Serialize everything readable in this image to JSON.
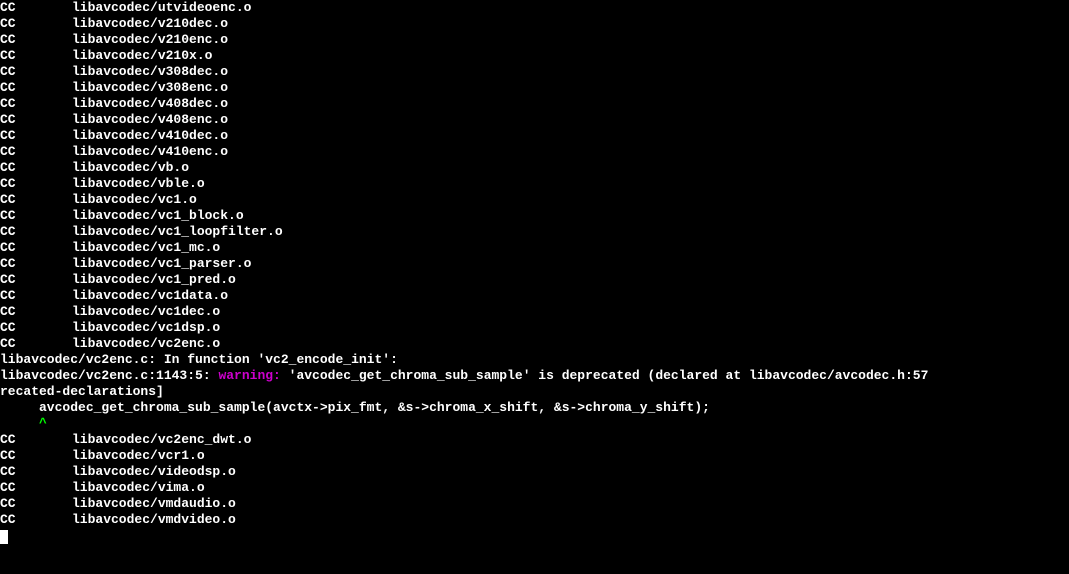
{
  "cc_lines_before": [
    {
      "label": "CC",
      "file": "libavcodec/utvideoenc.o"
    },
    {
      "label": "CC",
      "file": "libavcodec/v210dec.o"
    },
    {
      "label": "CC",
      "file": "libavcodec/v210enc.o"
    },
    {
      "label": "CC",
      "file": "libavcodec/v210x.o"
    },
    {
      "label": "CC",
      "file": "libavcodec/v308dec.o"
    },
    {
      "label": "CC",
      "file": "libavcodec/v308enc.o"
    },
    {
      "label": "CC",
      "file": "libavcodec/v408dec.o"
    },
    {
      "label": "CC",
      "file": "libavcodec/v408enc.o"
    },
    {
      "label": "CC",
      "file": "libavcodec/v410dec.o"
    },
    {
      "label": "CC",
      "file": "libavcodec/v410enc.o"
    },
    {
      "label": "CC",
      "file": "libavcodec/vb.o"
    },
    {
      "label": "CC",
      "file": "libavcodec/vble.o"
    },
    {
      "label": "CC",
      "file": "libavcodec/vc1.o"
    },
    {
      "label": "CC",
      "file": "libavcodec/vc1_block.o"
    },
    {
      "label": "CC",
      "file": "libavcodec/vc1_loopfilter.o"
    },
    {
      "label": "CC",
      "file": "libavcodec/vc1_mc.o"
    },
    {
      "label": "CC",
      "file": "libavcodec/vc1_parser.o"
    },
    {
      "label": "CC",
      "file": "libavcodec/vc1_pred.o"
    },
    {
      "label": "CC",
      "file": "libavcodec/vc1data.o"
    },
    {
      "label": "CC",
      "file": "libavcodec/vc1dec.o"
    },
    {
      "label": "CC",
      "file": "libavcodec/vc1dsp.o"
    },
    {
      "label": "CC",
      "file": "libavcodec/vc2enc.o"
    }
  ],
  "warning": {
    "file1": "libavcodec/vc2enc.c:",
    "infn": " In function ",
    "fnname": "'vc2_encode_init'",
    "colon1": ":",
    "file2": "libavcodec/vc2enc.c:1143:5: ",
    "warning_label": "warning: ",
    "deprecated_sym": "'avcodec_get_chroma_sub_sample'",
    "deprecated_msg": " is deprecated (declared at ",
    "declared_at": "libavcodec/avcodec.h:57",
    "wrap_tail": "recated-declarations]",
    "code_line": "     avcodec_get_chroma_sub_sample(avctx->pix_fmt, &s->chroma_x_shift, &s->chroma_y_shift);",
    "caret_line": "     ^"
  },
  "cc_lines_after": [
    {
      "label": "CC",
      "file": "libavcodec/vc2enc_dwt.o"
    },
    {
      "label": "CC",
      "file": "libavcodec/vcr1.o"
    },
    {
      "label": "CC",
      "file": "libavcodec/videodsp.o"
    },
    {
      "label": "CC",
      "file": "libavcodec/vima.o"
    },
    {
      "label": "CC",
      "file": "libavcodec/vmdaudio.o"
    },
    {
      "label": "CC",
      "file": "libavcodec/vmdvideo.o"
    }
  ]
}
